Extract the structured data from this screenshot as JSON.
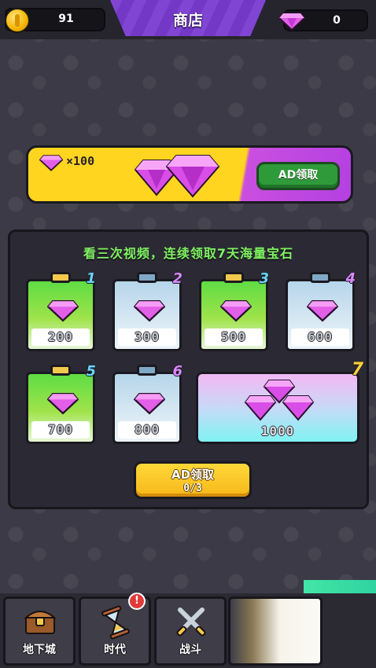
{
  "topbar": {
    "coins": "91",
    "title": "商店",
    "gems": "0"
  },
  "banner": {
    "gem_count": "×100",
    "button_label": "AD领取"
  },
  "panel": {
    "title": "看三次视频，连续领取7天海量宝石",
    "rewards": [
      {
        "day": "1",
        "amount": "200",
        "style": "green"
      },
      {
        "day": "2",
        "amount": "300",
        "style": "blue"
      },
      {
        "day": "3",
        "amount": "500",
        "style": "green"
      },
      {
        "day": "4",
        "amount": "600",
        "style": "blue"
      },
      {
        "day": "5",
        "amount": "700",
        "style": "green"
      },
      {
        "day": "6",
        "amount": "800",
        "style": "blue"
      },
      {
        "day": "7",
        "amount": "1000",
        "style": "rainbow"
      }
    ],
    "ad_button": {
      "label": "AD领取",
      "progress": "0/3"
    }
  },
  "nav": {
    "items": [
      {
        "label": "地下城",
        "icon": "treasure-chest-icon"
      },
      {
        "label": "时代",
        "icon": "hourglass-icon",
        "badge": "!"
      },
      {
        "label": "战斗",
        "icon": "crossed-swords-icon"
      }
    ]
  },
  "colors": {
    "accent_purple": "#7a3bd1",
    "banner_yellow": "#ffd51f",
    "button_green": "#2f9a3a",
    "panel_title_green": "#7ef25f"
  }
}
